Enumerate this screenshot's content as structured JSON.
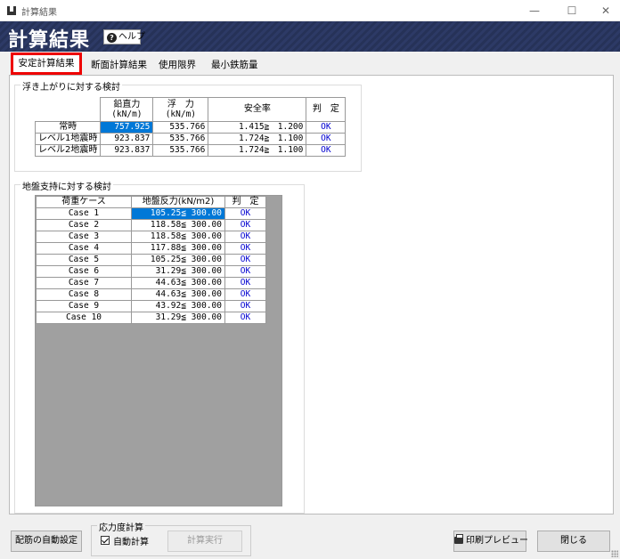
{
  "window": {
    "title": "計算結果",
    "minimize": "—",
    "maximize": "☐",
    "close": "✕"
  },
  "header": {
    "big_title": "計算結果",
    "help_label": "ヘルプ",
    "help_icon": "question-circle-icon"
  },
  "tabs": [
    {
      "label": "安定計算結果",
      "active": true
    },
    {
      "label": "断面計算結果",
      "active": false
    },
    {
      "label": "使用限界",
      "active": false
    },
    {
      "label": "最小鉄筋量",
      "active": false
    }
  ],
  "uplift": {
    "title": "浮き上がりに対する検討",
    "headers": {
      "vertical": "鉛直力",
      "vertical_unit": "(kN/m)",
      "buoyancy": "浮　力",
      "buoyancy_unit": "(kN/m)",
      "safety": "安全率",
      "judge": "判　定"
    },
    "rows": [
      {
        "case": "常時",
        "vertical": "757.925",
        "buoyancy": "535.766",
        "safety": "1.415≧　1.200",
        "judge": "OK"
      },
      {
        "case": "レベル1地震時",
        "vertical": "923.837",
        "buoyancy": "535.766",
        "safety": "1.724≧　1.100",
        "judge": "OK"
      },
      {
        "case": "レベル2地震時",
        "vertical": "923.837",
        "buoyancy": "535.766",
        "safety": "1.724≧　1.100",
        "judge": "OK"
      }
    ]
  },
  "bearing": {
    "title": "地盤支持に対する検討",
    "headers": {
      "case": "荷重ケース",
      "reaction": "地盤反力(kN/m2)",
      "judge": "判　定"
    },
    "rows": [
      {
        "case": "Case 1",
        "reaction": "105.25≦ 300.00",
        "judge": "OK"
      },
      {
        "case": "Case 2",
        "reaction": "118.58≦ 300.00",
        "judge": "OK"
      },
      {
        "case": "Case 3",
        "reaction": "118.58≦ 300.00",
        "judge": "OK"
      },
      {
        "case": "Case 4",
        "reaction": "117.88≦ 300.00",
        "judge": "OK"
      },
      {
        "case": "Case 5",
        "reaction": "105.25≦ 300.00",
        "judge": "OK"
      },
      {
        "case": "Case 6",
        "reaction": "31.29≦ 300.00",
        "judge": "OK"
      },
      {
        "case": "Case 7",
        "reaction": "44.63≦ 300.00",
        "judge": "OK"
      },
      {
        "case": "Case 8",
        "reaction": "44.63≦ 300.00",
        "judge": "OK"
      },
      {
        "case": "Case 9",
        "reaction": "43.92≦ 300.00",
        "judge": "OK"
      },
      {
        "case": "Case 10",
        "reaction": "31.29≦ 300.00",
        "judge": "OK"
      }
    ]
  },
  "footer": {
    "auto_rebar_label": "配筋の自動設定",
    "stress_group_title": "応力度計算",
    "auto_calc_label": "自動計算",
    "auto_calc_checked": true,
    "calc_exec_label": "計算実行",
    "print_preview_label": "印刷プレビュー",
    "close_label": "閉じる"
  },
  "colors": {
    "banner": "#2d3a66",
    "selection": "#0078d7",
    "ok_text": "#0000d0",
    "active_tab_border": "#ee0000",
    "grid_empty": "#a0a0a0"
  }
}
